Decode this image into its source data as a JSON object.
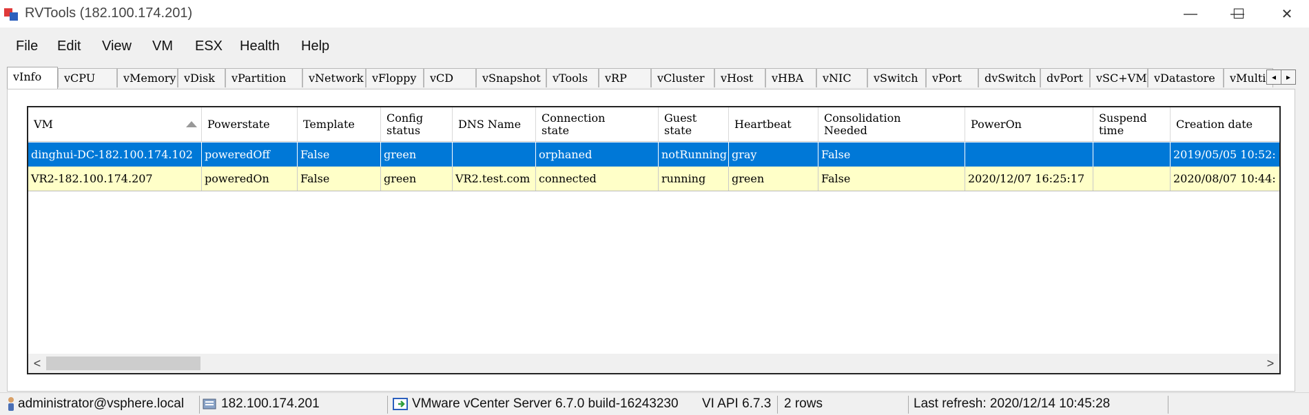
{
  "window": {
    "title": "RVTools (182.100.174.201)",
    "minimize_glyph": "—",
    "maximize_glyph": "☐",
    "close_glyph": "✕"
  },
  "menu": [
    "File",
    "Edit",
    "View",
    "VM",
    "ESX",
    "Health",
    "Help"
  ],
  "tabs": [
    {
      "label": "vInfo",
      "active": true
    },
    {
      "label": "vCPU"
    },
    {
      "label": "vMemory"
    },
    {
      "label": "vDisk"
    },
    {
      "label": "vPartition"
    },
    {
      "label": "vNetwork"
    },
    {
      "label": "vFloppy"
    },
    {
      "label": "vCD"
    },
    {
      "label": "vSnapshot"
    },
    {
      "label": "vTools"
    },
    {
      "label": "vRP"
    },
    {
      "label": "vCluster"
    },
    {
      "label": "vHost"
    },
    {
      "label": "vHBA"
    },
    {
      "label": "vNIC"
    },
    {
      "label": "vSwitch"
    },
    {
      "label": "vPort"
    },
    {
      "label": "dvSwitch"
    },
    {
      "label": "dvPort"
    },
    {
      "label": "vSC+VMK"
    },
    {
      "label": "vDatastore"
    },
    {
      "label": "vMulti"
    }
  ],
  "tab_scroll": {
    "left_glyph": "◂",
    "right_glyph": "▸"
  },
  "grid": {
    "columns": [
      "VM",
      "Powerstate",
      "Template",
      "Config\nstatus",
      "DNS Name",
      "Connection\nstate",
      "Guest\nstate",
      "Heartbeat",
      "Consolidation\nNeeded",
      "PowerOn",
      "Suspend\ntime",
      "Creation date"
    ],
    "rows": [
      [
        "dinghui-DC-182.100.174.102",
        "poweredOff",
        "False",
        "green",
        "",
        "orphaned",
        "notRunning",
        "gray",
        "False",
        "",
        "",
        "2019/05/05 10:52:"
      ],
      [
        "VR2-182.100.174.207",
        "poweredOn",
        "False",
        "green",
        "VR2.test.com",
        "connected",
        "running",
        "green",
        "False",
        "2020/12/07 16:25:17",
        "",
        "2020/08/07 10:44:"
      ]
    ],
    "selected_row": 0,
    "scroll_left_glyph": "<",
    "scroll_right_glyph": ">"
  },
  "status": {
    "user": "administrator@vsphere.local",
    "host": "182.100.174.201",
    "server": "VMware vCenter Server 6.7.0 build-16243230",
    "api": "VI API 6.7.3",
    "rows": "2 rows",
    "last_refresh": "Last refresh: 2020/12/14 10:45:28"
  },
  "colors": {
    "selected_row": "#0078d7",
    "row_bg": "#ffffc8"
  }
}
